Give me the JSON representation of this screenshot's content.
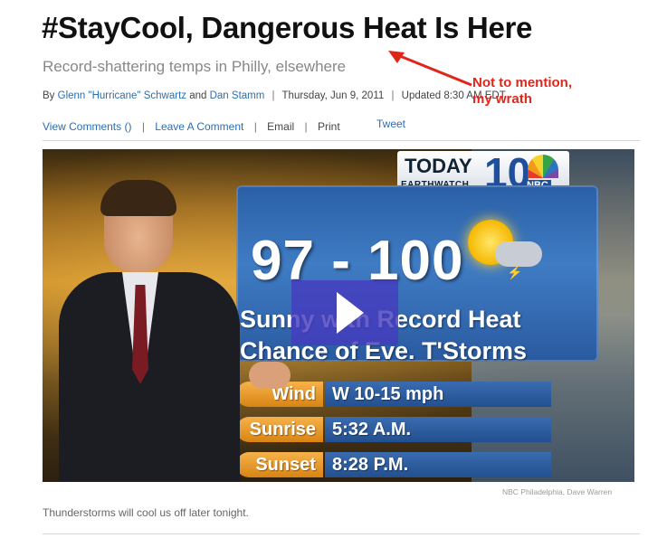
{
  "article": {
    "headline": "#StayCool, Dangerous Heat Is Here",
    "subhead": "Record-shattering temps in Philly, elsewhere",
    "byline": {
      "by": "By",
      "author1": "Glenn \"Hurricane\" Schwartz",
      "and": "and",
      "author2": "Dan Stamm",
      "date": "Thursday, Jun 9, 2011",
      "updated": "Updated 8:30 AM EDT"
    },
    "actions": {
      "view_comments": "View Comments ()",
      "leave_comment": "Leave A Comment",
      "email": "Email",
      "print": "Print",
      "tweet": "Tweet"
    },
    "separator": "|"
  },
  "annotation": {
    "line1": "Not to mention,",
    "line2": "my wrath"
  },
  "video": {
    "logo_today": "TODAY",
    "logo_number": "10",
    "logo_sub": "EARTHWATCH",
    "logo_network": "NBC",
    "temperature": "97 - 100",
    "forecast_line1": "Sunny with Record Heat",
    "forecast_line2": "Chance of Eve. T'Storms",
    "rows": [
      {
        "label": "Wind",
        "value": "W 10-15 mph"
      },
      {
        "label": "Sunrise",
        "value": "5:32 A.M."
      },
      {
        "label": "Sunset",
        "value": "8:28 P.M."
      }
    ],
    "credit": "NBC Philadelphia, Dave Warren",
    "caption": "Thunderstorms will cool us off later tonight."
  },
  "colors": {
    "link": "#2a6fb3",
    "annotation": "#e0261a",
    "play_button": "#463cbe"
  }
}
